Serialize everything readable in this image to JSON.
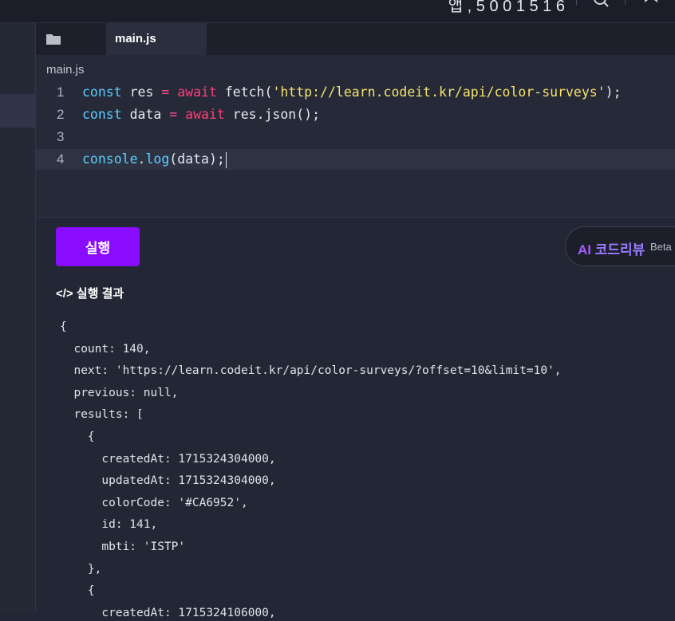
{
  "header": {
    "title": "앱 , 5 0 0 1 5 1 6"
  },
  "tabs": [
    {
      "label": "main.js"
    }
  ],
  "editor": {
    "file_label": "main.js",
    "lines": [
      {
        "num": "1",
        "tokens": [
          {
            "t": "const",
            "c": "kw"
          },
          {
            "t": " res ",
            "c": "fn"
          },
          {
            "t": "=",
            "c": "op"
          },
          {
            "t": " ",
            "c": "fn"
          },
          {
            "t": "await",
            "c": "aw"
          },
          {
            "t": " fetch(",
            "c": "fn"
          },
          {
            "t": "'http://learn.codeit.kr/api/color-surveys'",
            "c": "str"
          },
          {
            "t": ");",
            "c": "fn"
          }
        ]
      },
      {
        "num": "2",
        "tokens": [
          {
            "t": "const",
            "c": "kw"
          },
          {
            "t": " data ",
            "c": "fn"
          },
          {
            "t": "=",
            "c": "op"
          },
          {
            "t": " ",
            "c": "fn"
          },
          {
            "t": "await",
            "c": "aw"
          },
          {
            "t": " res.json();",
            "c": "fn"
          }
        ]
      },
      {
        "num": "3",
        "tokens": []
      },
      {
        "num": "4",
        "tokens": [
          {
            "t": "console",
            "c": "meth"
          },
          {
            "t": ".",
            "c": "fn"
          },
          {
            "t": "log",
            "c": "meth"
          },
          {
            "t": "(data);",
            "c": "fn"
          }
        ]
      }
    ]
  },
  "run_button": {
    "label": "실행"
  },
  "ai_review": {
    "ai": "AI",
    "label": "코드리뷰",
    "beta": "Beta"
  },
  "output": {
    "heading": "</> 실행 결과",
    "lines": [
      "{",
      "  count: 140,",
      "  next: 'https://learn.codeit.kr/api/color-surveys/?offset=10&limit=10',",
      "  previous: null,",
      "  results: [",
      "    {",
      "      createdAt: 1715324304000,",
      "      updatedAt: 1715324304000,",
      "      colorCode: '#CA6952',",
      "      id: 141,",
      "      mbti: 'ISTP'",
      "    },",
      "    {",
      "      createdAt: 1715324106000,"
    ]
  }
}
